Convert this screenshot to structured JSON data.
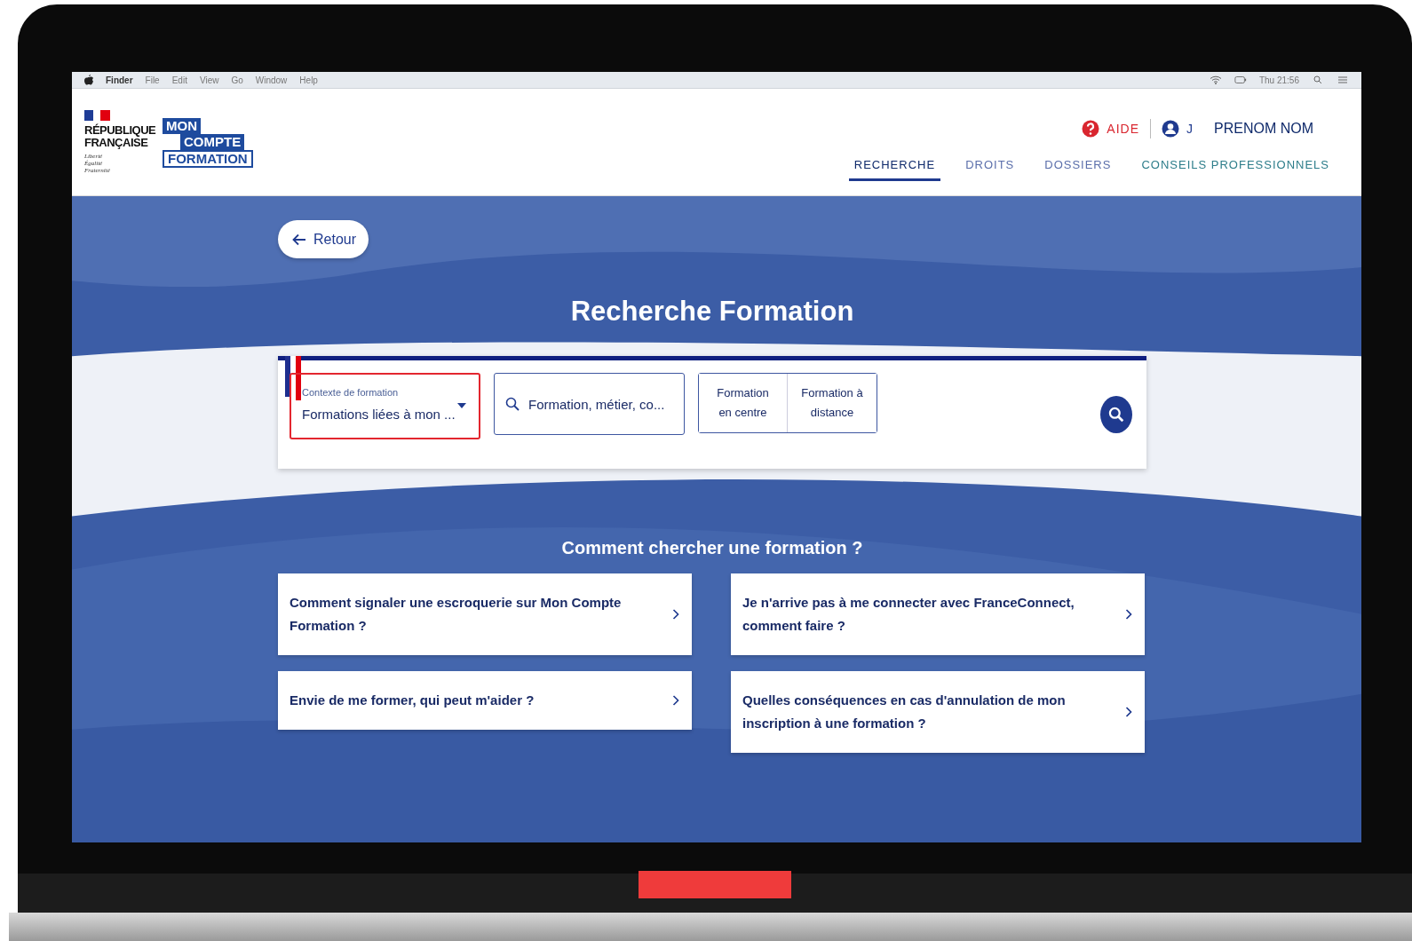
{
  "menubar": {
    "items": [
      "Finder",
      "File",
      "Edit",
      "View",
      "Go",
      "Window",
      "Help"
    ],
    "clock": "Thu 21:56"
  },
  "header": {
    "republic": [
      "RÉPUBLIQUE",
      "FRANÇAISE"
    ],
    "motto": [
      "Liberté",
      "Égalité",
      "Fraternité"
    ],
    "brand": [
      "MON",
      "COMPTE",
      "FORMATION"
    ],
    "help": "AIDE",
    "user_initial": "J",
    "user_name": "PRENOM NOM",
    "nav": [
      {
        "label": "RECHERCHE",
        "selected": true
      },
      {
        "label": "DROITS",
        "selected": false
      },
      {
        "label": "DOSSIERS",
        "selected": false
      },
      {
        "label": "CONSEILS PROFESSIONNELS",
        "selected": false
      }
    ]
  },
  "back_button": "Retour",
  "title": "Recherche Formation",
  "search": {
    "context_label": "Contexte de formation",
    "context_value": "Formations liées à mon ...",
    "keyword_placeholder": "Formation, métier, co...",
    "modes": [
      "Formation en centre",
      "Formation à distance"
    ]
  },
  "faq": {
    "title": "Comment chercher une formation ?",
    "questions": [
      "Comment signaler une escroquerie sur Mon Compte Formation ?",
      "Je n'arrive pas à me connecter avec FranceConnect, comment faire ?",
      "Envie de me former, qui peut m'aider ?",
      "Quelles conséquences en cas d'annulation de mon inscription à une formation ?"
    ]
  }
}
